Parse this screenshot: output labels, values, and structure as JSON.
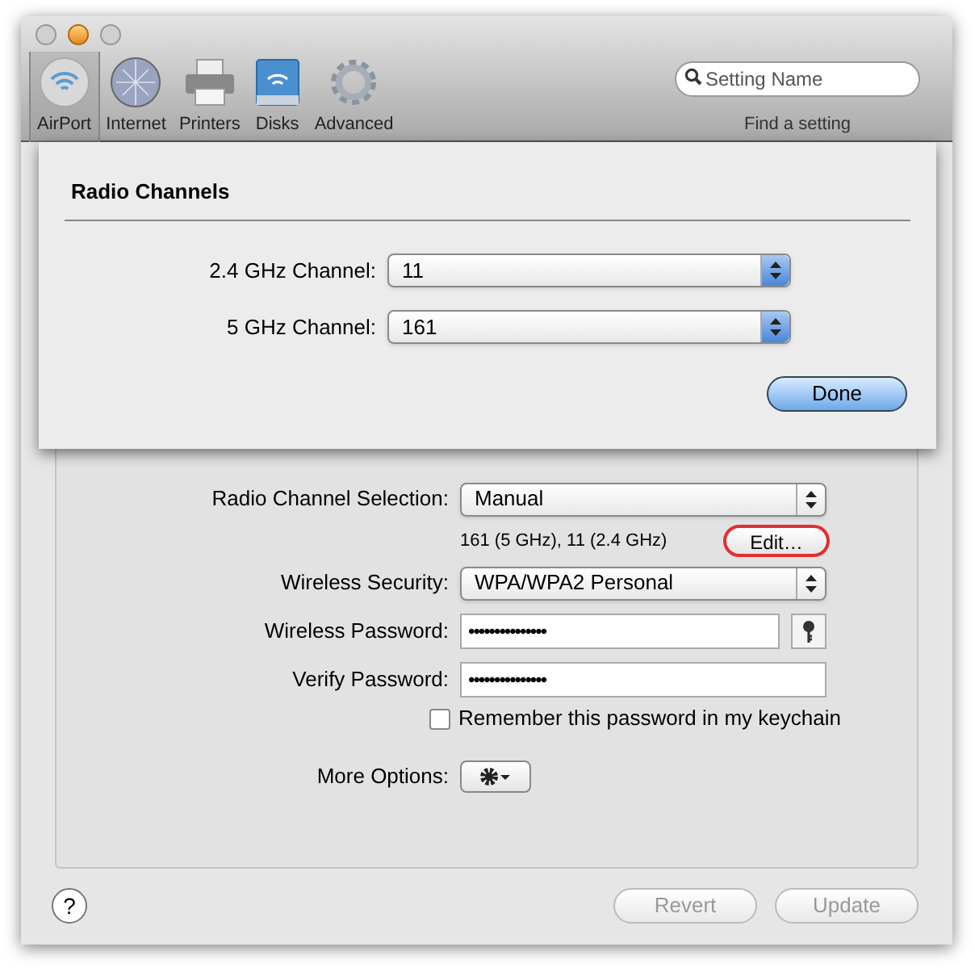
{
  "toolbar": {
    "items": [
      {
        "label": "AirPort",
        "kind": "wifi",
        "selected": true
      },
      {
        "label": "Internet",
        "kind": "globe",
        "selected": false
      },
      {
        "label": "Printers",
        "kind": "printer",
        "selected": false
      },
      {
        "label": "Disks",
        "kind": "disk",
        "selected": false
      },
      {
        "label": "Advanced",
        "kind": "gear",
        "selected": false
      }
    ],
    "search": {
      "placeholder": "Setting Name",
      "caption": "Find a setting"
    }
  },
  "sheet": {
    "title": "Radio Channels",
    "fields": [
      {
        "label": "2.4 GHz Channel:",
        "value": "11"
      },
      {
        "label": "5 GHz Channel:",
        "value": "161"
      }
    ],
    "button": "Done"
  },
  "form": {
    "channel_selection": {
      "label": "Radio Channel Selection:",
      "value": "Manual",
      "note": "161 (5 GHz), 11 (2.4 GHz)",
      "button": "Edit…"
    },
    "security": {
      "label": "Wireless Security:",
      "value": "WPA/WPA2 Personal"
    },
    "password": {
      "label": "Wireless Password:",
      "value": "•••••••••••••••"
    },
    "verify": {
      "label": "Verify Password:",
      "value": "•••••••••••••••"
    },
    "keychain": {
      "label": "Remember this password in my keychain",
      "checked": false
    },
    "more_options": {
      "label": "More Options:"
    }
  },
  "footer": {
    "help": "?",
    "buttons": [
      {
        "label": "Revert",
        "disabled": true
      },
      {
        "label": "Update",
        "disabled": true
      }
    ]
  }
}
